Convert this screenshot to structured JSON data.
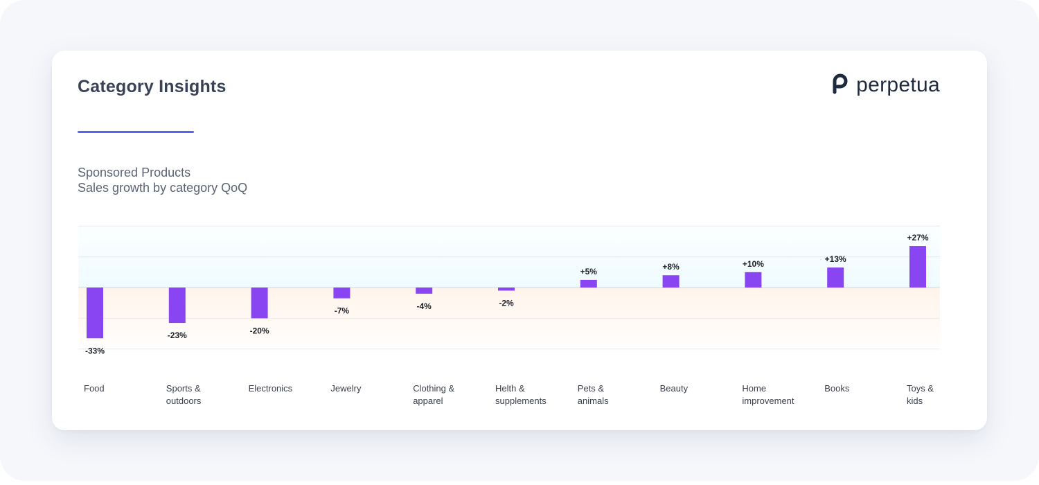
{
  "card": {
    "title": "Category Insights",
    "brand_name": "perpetua",
    "brand_icon": "perpetua-logo-icon",
    "subtitle_line1": "Sponsored Products",
    "subtitle_line2": "Sales growth by category QoQ"
  },
  "colors": {
    "bar": "#8a45f2",
    "accent_underline": "#5566ee",
    "positive_zone": "#eefbfd",
    "negative_zone": "#fff4ea",
    "gridline": "#e7eaf0"
  },
  "chart_data": {
    "type": "bar",
    "categories": [
      [
        "Food"
      ],
      [
        "Sports &",
        "outdoors"
      ],
      [
        "Electronics"
      ],
      [
        "Jewelry"
      ],
      [
        "Clothing &",
        "apparel"
      ],
      [
        "Helth &",
        "supplements"
      ],
      [
        "Pets &",
        "animals"
      ],
      [
        "Beauty"
      ],
      [
        "Home",
        "improvement"
      ],
      [
        "Books"
      ],
      [
        "Toys &",
        "kids"
      ]
    ],
    "values": [
      -33,
      -23,
      -20,
      -7,
      -4,
      -2,
      5,
      8,
      10,
      13,
      27
    ],
    "value_labels": [
      "-33%",
      "-23%",
      "-20%",
      "-7%",
      "-4%",
      "-2%",
      "+5%",
      "+8%",
      "+10%",
      "+13%",
      "+27%"
    ],
    "ylim": [
      -40,
      40
    ],
    "grid": true,
    "legend": "none",
    "title": "",
    "xlabel": "",
    "ylabel": ""
  }
}
